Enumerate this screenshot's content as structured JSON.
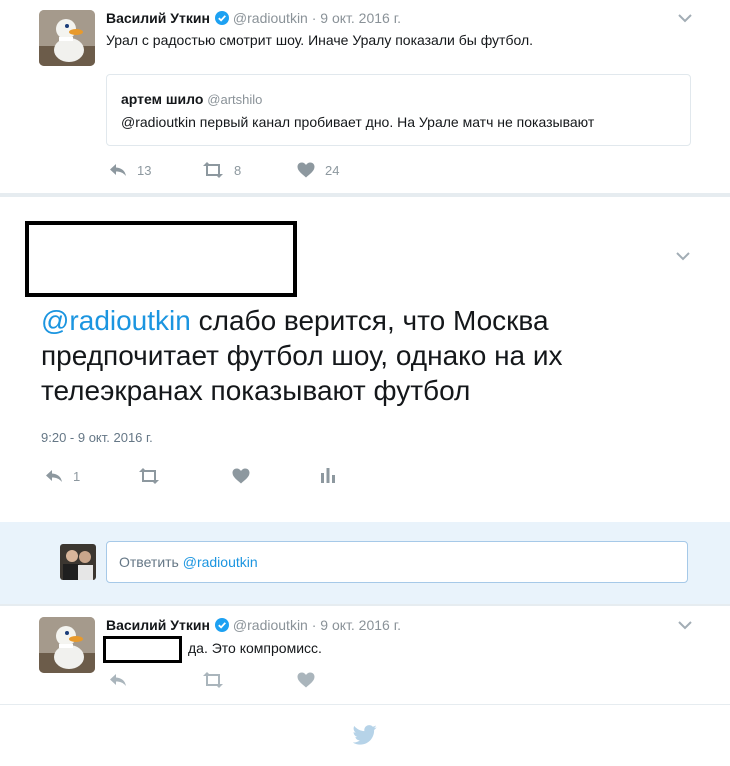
{
  "tweet1": {
    "author_name": "Василий Уткин",
    "handle": "@radioutkin",
    "dot": "·",
    "date": "9 окт. 2016 г.",
    "text": "Урал с радостью смотрит шоу. Иначе Уралу показали бы футбол.",
    "quote": {
      "author_name": "артем шило",
      "handle": "@artshilo",
      "text": "@radioutkin первый канал пробивает дно. На Урале матч не показывают"
    },
    "reply_count": "13",
    "retweet_count": "8",
    "like_count": "24"
  },
  "main_tweet": {
    "mention": "@radioutkin",
    "text": " слабо верится, что Москва предпочитает футбол шоу, однако на их телеэкранах показывают футбол",
    "timestamp": "9:20 - 9 окт. 2016 г.",
    "reply_count": "1"
  },
  "reply_composer": {
    "prefix": "Ответить ",
    "mention": "@radioutkin"
  },
  "tweet3": {
    "author_name": "Василий Уткин",
    "handle": "@radioutkin",
    "dot": "·",
    "date": "9 окт. 2016 г.",
    "text": "да. Это компромисс."
  },
  "colors": {
    "accent": "#1b95e0",
    "action_gray": "#8d989f",
    "verified_blue": "#1da1f2",
    "separator": "#e6ecf0"
  }
}
